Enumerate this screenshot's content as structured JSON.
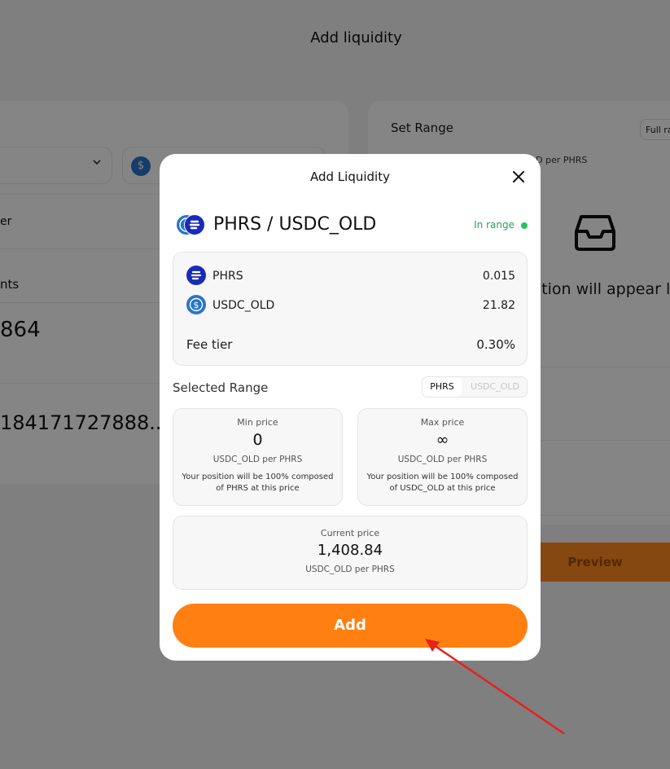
{
  "background": {
    "page_title": "Add liquidity",
    "left_fragments": {
      "fee_label": "er",
      "amounts_label": "nts",
      "amount_value": "864",
      "long_value": "184171727888..."
    },
    "right_panel": {
      "set_range": "Set Range",
      "full_range": "Full ra",
      "per_phrs": "LD per PHRS",
      "empty_text": "sition will appear l",
      "preview_button": "Preview"
    }
  },
  "modal": {
    "title": "Add Liquidity",
    "pair": "PHRS / USDC_OLD",
    "status": "In range",
    "tokens": [
      {
        "name": "PHRS",
        "amount": "0.015",
        "icon": "phrs-icon"
      },
      {
        "name": "USDC_OLD",
        "amount": "21.82",
        "icon": "usdc-icon"
      }
    ],
    "fee_tier_label": "Fee tier",
    "fee_tier_value": "0.30%",
    "selected_range_label": "Selected Range",
    "toggle": {
      "active": "PHRS",
      "inactive": "USDC_OLD"
    },
    "min_price": {
      "label": "Min price",
      "value": "0",
      "unit": "USDC_OLD per PHRS",
      "note": "Your position will be 100% composed of PHRS at this price"
    },
    "max_price": {
      "label": "Max price",
      "value": "∞",
      "unit": "USDC_OLD per PHRS",
      "note": "Your position will be 100% composed of USDC_OLD at this price"
    },
    "current_price": {
      "label": "Current price",
      "value": "1,408.84",
      "unit": "USDC_OLD per PHRS"
    },
    "add_button": "Add"
  },
  "colors": {
    "accent": "#ff7f11",
    "in_range": "#22a355",
    "annotation_arrow": "#e8211a"
  }
}
